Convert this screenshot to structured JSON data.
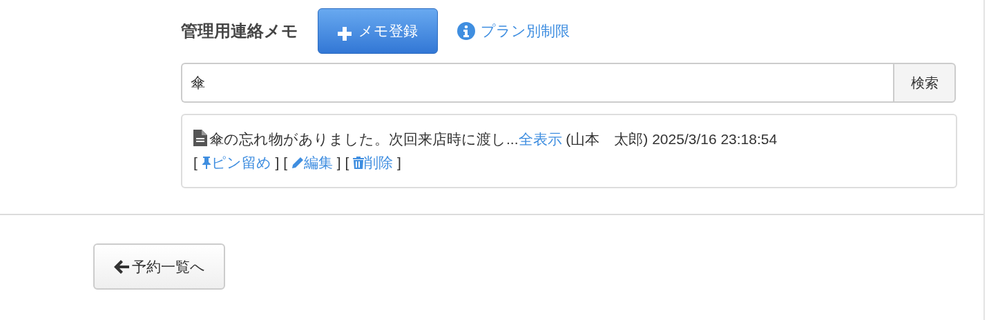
{
  "header": {
    "title": "管理用連絡メモ",
    "add_button": "メモ登録",
    "plan_link": "プラン別制限"
  },
  "search": {
    "value": "傘",
    "button": "検索"
  },
  "memos": [
    {
      "text": "傘の忘れ物がありました。次回来店時に渡し...",
      "show_all": "全表示",
      "meta": "(山本　太郎) 2025/3/16 23:18:54",
      "actions": [
        {
          "kind": "pin",
          "label": "ピン留め",
          "open": "[",
          "close": "]"
        },
        {
          "kind": "edit",
          "label": "編集",
          "open": "[",
          "close": "]"
        },
        {
          "kind": "delete",
          "label": "削除",
          "open": "[",
          "close": "]"
        }
      ]
    }
  ],
  "back_button": "予約一覧へ"
}
